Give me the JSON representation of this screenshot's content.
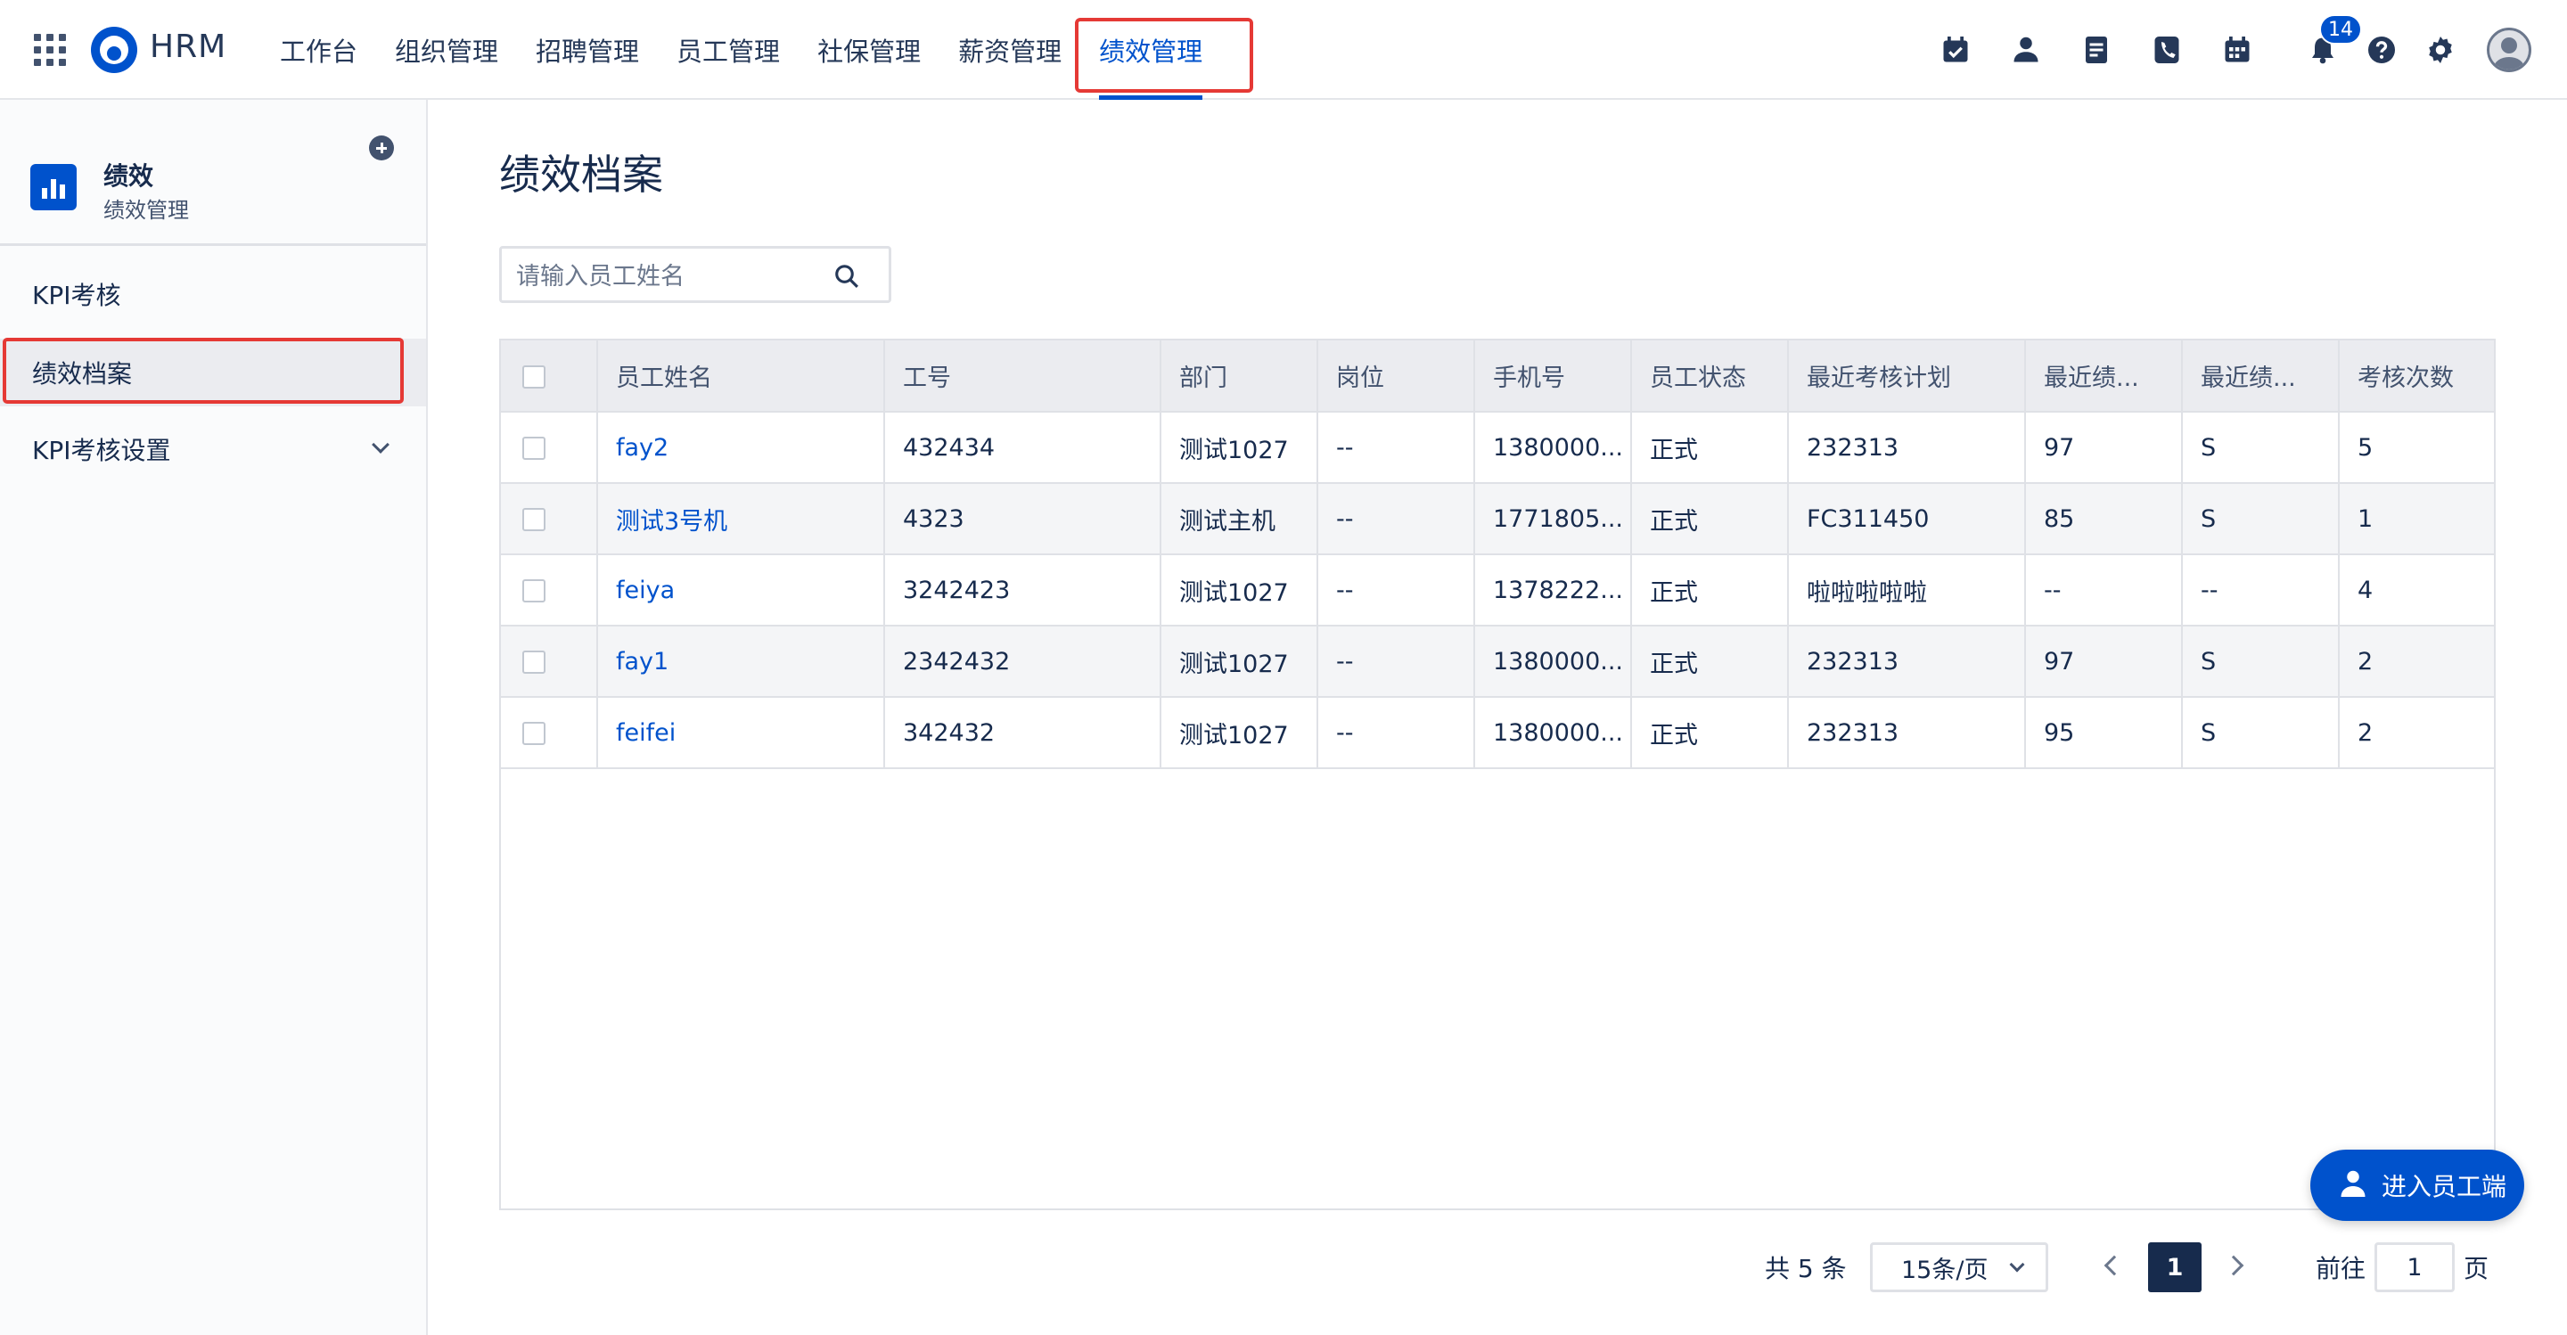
{
  "app": {
    "brand": "HRM"
  },
  "nav": {
    "items": [
      {
        "label": "工作台"
      },
      {
        "label": "组织管理"
      },
      {
        "label": "招聘管理"
      },
      {
        "label": "员工管理"
      },
      {
        "label": "社保管理"
      },
      {
        "label": "薪资管理"
      },
      {
        "label": "绩效管理"
      }
    ],
    "active_index": 6
  },
  "topbar_icons": [
    "calendar-check-icon",
    "user-icon",
    "document-icon",
    "phone-icon",
    "calendar-icon",
    "bell-icon",
    "help-icon",
    "gear-icon",
    "avatar"
  ],
  "notifications": {
    "count": "14"
  },
  "sidebar": {
    "title": "绩效",
    "subtitle": "绩效管理",
    "items": [
      {
        "label": "KPI考核"
      },
      {
        "label": "绩效档案"
      },
      {
        "label": "KPI考核设置"
      }
    ],
    "active_index": 1
  },
  "main": {
    "title": "绩效档案",
    "search": {
      "placeholder": "请输入员工姓名",
      "value": ""
    },
    "table": {
      "columns": [
        "员工姓名",
        "工号",
        "部门",
        "岗位",
        "手机号",
        "员工状态",
        "最近考核计划",
        "最近绩...",
        "最近绩...",
        "考核次数"
      ],
      "rows": [
        {
          "name": "fay2",
          "id": "432434",
          "dept": "测试1027",
          "post": "--",
          "phone": "1380000...",
          "status": "正式",
          "plan": "232313",
          "score": "97",
          "grade": "S",
          "count": "5"
        },
        {
          "name": "测试3号机",
          "id": "4323",
          "dept": "测试主机",
          "post": "--",
          "phone": "1771805...",
          "status": "正式",
          "plan": "FC311450",
          "score": "85",
          "grade": "S",
          "count": "1"
        },
        {
          "name": "feiya",
          "id": "3242423",
          "dept": "测试1027",
          "post": "--",
          "phone": "1378222...",
          "status": "正式",
          "plan": "啦啦啦啦啦",
          "score": "--",
          "grade": "--",
          "count": "4"
        },
        {
          "name": "fay1",
          "id": "2342432",
          "dept": "测试1027",
          "post": "--",
          "phone": "1380000...",
          "status": "正式",
          "plan": "232313",
          "score": "97",
          "grade": "S",
          "count": "2"
        },
        {
          "name": "feifei",
          "id": "342432",
          "dept": "测试1027",
          "post": "--",
          "phone": "1380000...",
          "status": "正式",
          "plan": "232313",
          "score": "95",
          "grade": "S",
          "count": "2"
        }
      ]
    }
  },
  "pagination": {
    "total_label": "共 5 条",
    "page_size": "15条/页",
    "current_page": "1",
    "goto_label": "前往",
    "goto_value": "1",
    "goto_suffix": "页"
  },
  "fab": {
    "label": "进入员工端"
  },
  "colors": {
    "accent": "#0052cc",
    "highlight": "#e53935",
    "text": "#172b4d"
  }
}
